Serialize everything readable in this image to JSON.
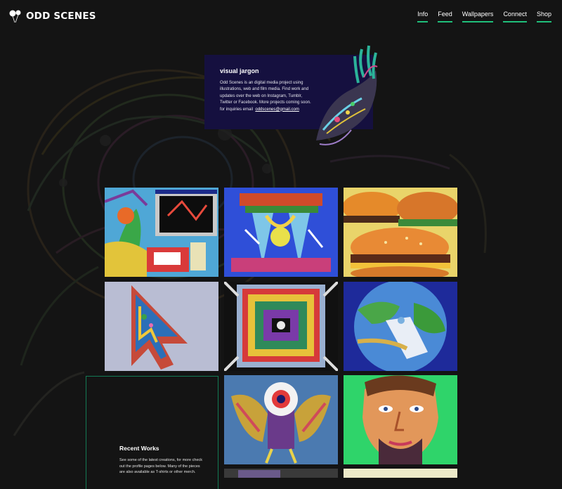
{
  "brand": {
    "name": "ODD SCENES"
  },
  "nav": {
    "items": [
      "Info",
      "Feed",
      "Wallpapers",
      "Connect",
      "Shop"
    ],
    "accent": "#1fbf7a"
  },
  "info": {
    "title": "visual jargon",
    "description": "Odd Scenes is an digital media project using illustrations, web and film media. Find work and updates over the web on Instagram, Tumblr, Twitter or Facebook. More projects coming soon. for inquiries email",
    "email": "oddscenes@gmail.com",
    "background": "#15103f"
  },
  "gallery": {
    "items": [
      {
        "subject": "desktop-collage-artwork"
      },
      {
        "subject": "blue-temple-artwork"
      },
      {
        "subject": "burgers-artwork"
      },
      {
        "subject": "cursor-arrow-artwork"
      },
      {
        "subject": "mandala-frame-artwork"
      },
      {
        "subject": "earth-bag-artwork"
      },
      {
        "subject": "eye-bird-artwork"
      },
      {
        "subject": "portrait-face-artwork"
      },
      {
        "subject": "partial-artwork"
      }
    ]
  },
  "recent": {
    "title": "Recent Works",
    "description": "See some of the latest creations, for more check out the profile pages below. Many of the pieces are also available as T-shirts or other merch."
  }
}
